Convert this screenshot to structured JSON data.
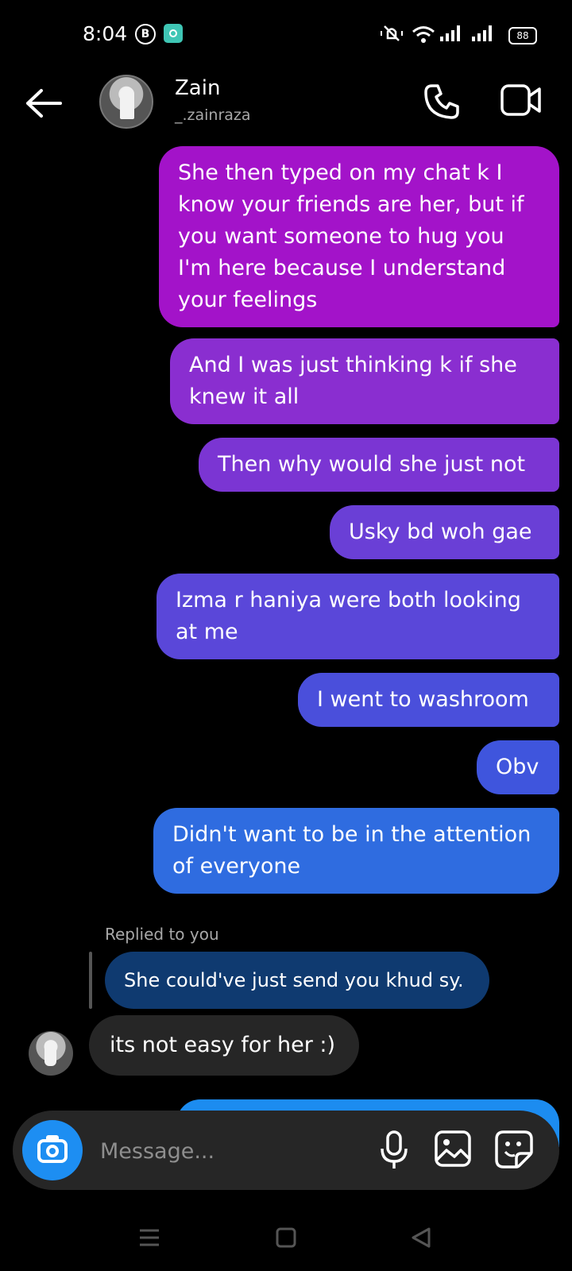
{
  "status_bar": {
    "time": "8:04",
    "badge_letter": "B",
    "battery": "88"
  },
  "header": {
    "name": "Zain",
    "username": "_.zainraza"
  },
  "messages": [
    {
      "text": "She then typed on my chat k I know your friends are her, but if you want someone to hug you I'm here because I understand your feelings",
      "color": "#a313c9"
    },
    {
      "text": "And I was just thinking k if she knew it all",
      "color": "#8a2ed0"
    },
    {
      "text": "Then why would she just not",
      "color": "#7b35d3"
    },
    {
      "text": "Usky bd woh gae",
      "color": "#6a3fd6"
    },
    {
      "text": "Izma r haniya were both looking at me",
      "color": "#5a47d9"
    },
    {
      "text": "I went to washroom",
      "color": "#4a4fdb"
    },
    {
      "text": "Obv",
      "color": "#3f55dd"
    },
    {
      "text": "Didn't want to be in the attention of everyone",
      "color": "#2f6ce0"
    }
  ],
  "reply": {
    "label": "Replied to you",
    "quoted": "She could've just send you khud sy."
  },
  "incoming": {
    "text": "its not easy for her :)"
  },
  "composer": {
    "placeholder": "Message..."
  },
  "icons": [
    "back-arrow-icon",
    "phone-icon",
    "video-camera-icon",
    "camera-icon",
    "microphone-icon",
    "gallery-icon",
    "sticker-icon"
  ]
}
